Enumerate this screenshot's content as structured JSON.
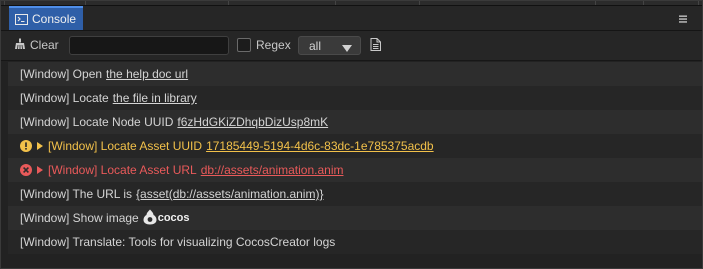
{
  "panel": {
    "tab_label": "Console",
    "menu_icon": "hamburger-menu-icon"
  },
  "toolbar": {
    "clear_label": "Clear",
    "search_value": "",
    "search_placeholder": "",
    "regex_label": "Regex",
    "regex_checked": false,
    "level_select": "all",
    "copy_icon": "document-icon"
  },
  "logs": [
    {
      "level": "log",
      "text": "[Window] Open",
      "link": "the help doc url"
    },
    {
      "level": "log",
      "text": "[Window] Locate",
      "link": "the file in library"
    },
    {
      "level": "log",
      "text": "[Window] Locate Node UUID",
      "link": "f6zHdGKiZDhqbDizUsp8mK"
    },
    {
      "level": "warn",
      "text": "[Window] Locate Asset UUID",
      "link": "17185449-5194-4d6c-83dc-1e785375acdb"
    },
    {
      "level": "error",
      "text": "[Window] Locate Asset URL",
      "link": "db://assets/animation.anim"
    },
    {
      "level": "log",
      "text": "[Window] The URL is",
      "link": "{asset(db://assets/animation.anim)}"
    },
    {
      "level": "log",
      "text": "[Window] Show image",
      "image_label": "cocos"
    },
    {
      "level": "log",
      "text": "[Window] Translate: Tools for visualizing CocosCreator logs"
    }
  ],
  "colors": {
    "tab_active": "#2f5fa8",
    "warn": "#f2c14a",
    "error": "#e95a5a",
    "text": "#d4d4d4"
  }
}
